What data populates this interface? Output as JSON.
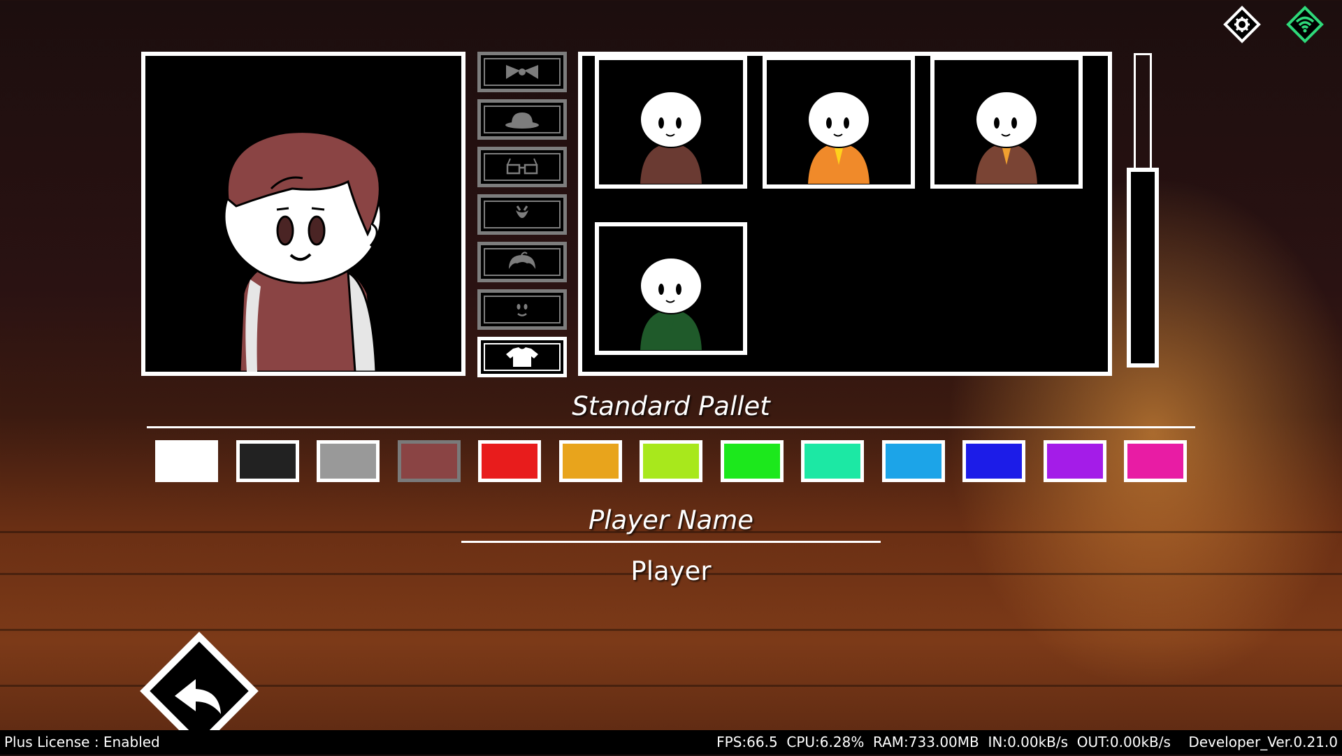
{
  "palette": {
    "title": "Standard Pallet",
    "colors": [
      "#ffffff",
      "#222222",
      "#999999",
      "#8a4444",
      "#e81c1c",
      "#e8a41c",
      "#a8e81c",
      "#1ce81c",
      "#1ce8a4",
      "#1ca4e8",
      "#1c1ce8",
      "#a41ce8",
      "#e81ca4"
    ],
    "selected_index": 3
  },
  "player": {
    "label": "Player Name",
    "value": "Player"
  },
  "categories": [
    {
      "name": "bow-icon",
      "active": false
    },
    {
      "name": "hat-icon",
      "active": false
    },
    {
      "name": "glasses-icon",
      "active": false
    },
    {
      "name": "face-accessory-icon",
      "active": false
    },
    {
      "name": "hair-icon",
      "active": false
    },
    {
      "name": "face-icon",
      "active": false
    },
    {
      "name": "shirt-icon",
      "active": true
    }
  ],
  "outfits": [
    {
      "name": "brown-robe",
      "color": "#6a3a32",
      "accent": "#6a3a32"
    },
    {
      "name": "orange-yellow-dress",
      "color": "#f08a2a",
      "accent": "#ffd21c"
    },
    {
      "name": "brown-coat-orange",
      "color": "#7a4434",
      "accent": "#f0a030"
    },
    {
      "name": "green-coat",
      "color": "#1f5a2a",
      "accent": "#1f5a2a"
    }
  ],
  "top_icons": [
    "settings-icon",
    "wifi-icon"
  ],
  "status": {
    "license": "Plus License : Enabled",
    "metrics": "FPS:66.5  CPU:6.28%  RAM:733.00MB  IN:0.00kB/s  OUT:0.00kB/s    Developer_Ver.0.21.0"
  },
  "colors": {
    "accent": "#ffffff",
    "wifi": "#2fd97a",
    "hair": "#8a4444",
    "shirt": "#8a4444"
  }
}
